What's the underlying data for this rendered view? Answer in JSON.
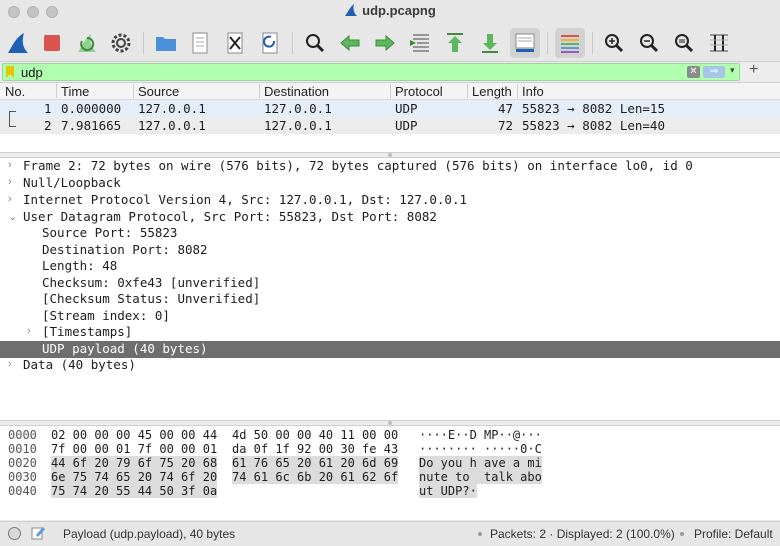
{
  "window": {
    "title": "udp.pcapng"
  },
  "filter": {
    "value": "udp",
    "clear_glyph": "✕",
    "apply_glyph": "⇒",
    "dropdown_glyph": "▾",
    "add_glyph": "+"
  },
  "packet_list": {
    "columns": [
      "No.",
      "Time",
      "Source",
      "Destination",
      "Protocol",
      "Length",
      "Info"
    ],
    "rows": [
      {
        "no": "1",
        "time": "0.000000",
        "source": "127.0.0.1",
        "destination": "127.0.0.1",
        "protocol": "UDP",
        "length": "47",
        "info": "55823 → 8082 Len=15"
      },
      {
        "no": "2",
        "time": "7.981665",
        "source": "127.0.0.1",
        "destination": "127.0.0.1",
        "protocol": "UDP",
        "length": "72",
        "info": "55823 → 8082 Len=40"
      }
    ]
  },
  "details": {
    "rows": [
      {
        "text": "Frame 2: 72 bytes on wire (576 bits), 72 bytes captured (576 bits) on interface lo0, id 0",
        "arrow": "›"
      },
      {
        "text": "Null/Loopback",
        "arrow": "›"
      },
      {
        "text": "Internet Protocol Version 4, Src: 127.0.0.1, Dst: 127.0.0.1",
        "arrow": "›"
      },
      {
        "text": "User Datagram Protocol, Src Port: 55823, Dst Port: 8082",
        "arrow": "⌄"
      },
      {
        "text": "Source Port: 55823",
        "arrow": ""
      },
      {
        "text": "Destination Port: 8082",
        "arrow": ""
      },
      {
        "text": "Length: 48",
        "arrow": ""
      },
      {
        "text": "Checksum: 0xfe43 [unverified]",
        "arrow": ""
      },
      {
        "text": "[Checksum Status: Unverified]",
        "arrow": ""
      },
      {
        "text": "[Stream index: 0]",
        "arrow": ""
      },
      {
        "text": "[Timestamps]",
        "arrow": "›"
      },
      {
        "text": "UDP payload (40 bytes)",
        "arrow": ""
      },
      {
        "text": "Data (40 bytes)",
        "arrow": "›"
      }
    ]
  },
  "bytes": {
    "rows": [
      {
        "offset": "0000",
        "hex1": "02 00 00 00 45 00 00 44",
        "hex2": "4d 50 00 00 40 11 00 00",
        "ascii": "····E··D MP··@···"
      },
      {
        "offset": "0010",
        "hex1": "7f 00 00 01 7f 00 00 01",
        "hex2": "da 0f 1f 92 00 30 fe 43",
        "ascii": "········ ·····0·C"
      },
      {
        "offset": "0020",
        "hex1": "44 6f 20 79 6f 75 20 68",
        "hex2": "61 76 65 20 61 20 6d 69",
        "ascii": "Do you h ave a mi"
      },
      {
        "offset": "0030",
        "hex1": "6e 75 74 65 20 74 6f 20",
        "hex2": "74 61 6c 6b 20 61 62 6f",
        "ascii": "nute to  talk abo"
      },
      {
        "offset": "0040",
        "hex1": "75 74 20 55 44 50 3f 0a",
        "hex2": "",
        "ascii": "ut UDP?·"
      }
    ]
  },
  "status": {
    "field": "Payload (udp.payload), 40 bytes",
    "packets": "Packets: 2 · Displayed: 2 (100.0%)",
    "profile": "Profile: Default"
  },
  "colors": {
    "filter_ok": "#afffaf",
    "selected_row": "#e3eef9",
    "highlight": "#6e6e6e",
    "shark_fin": "#1f5fb4"
  }
}
